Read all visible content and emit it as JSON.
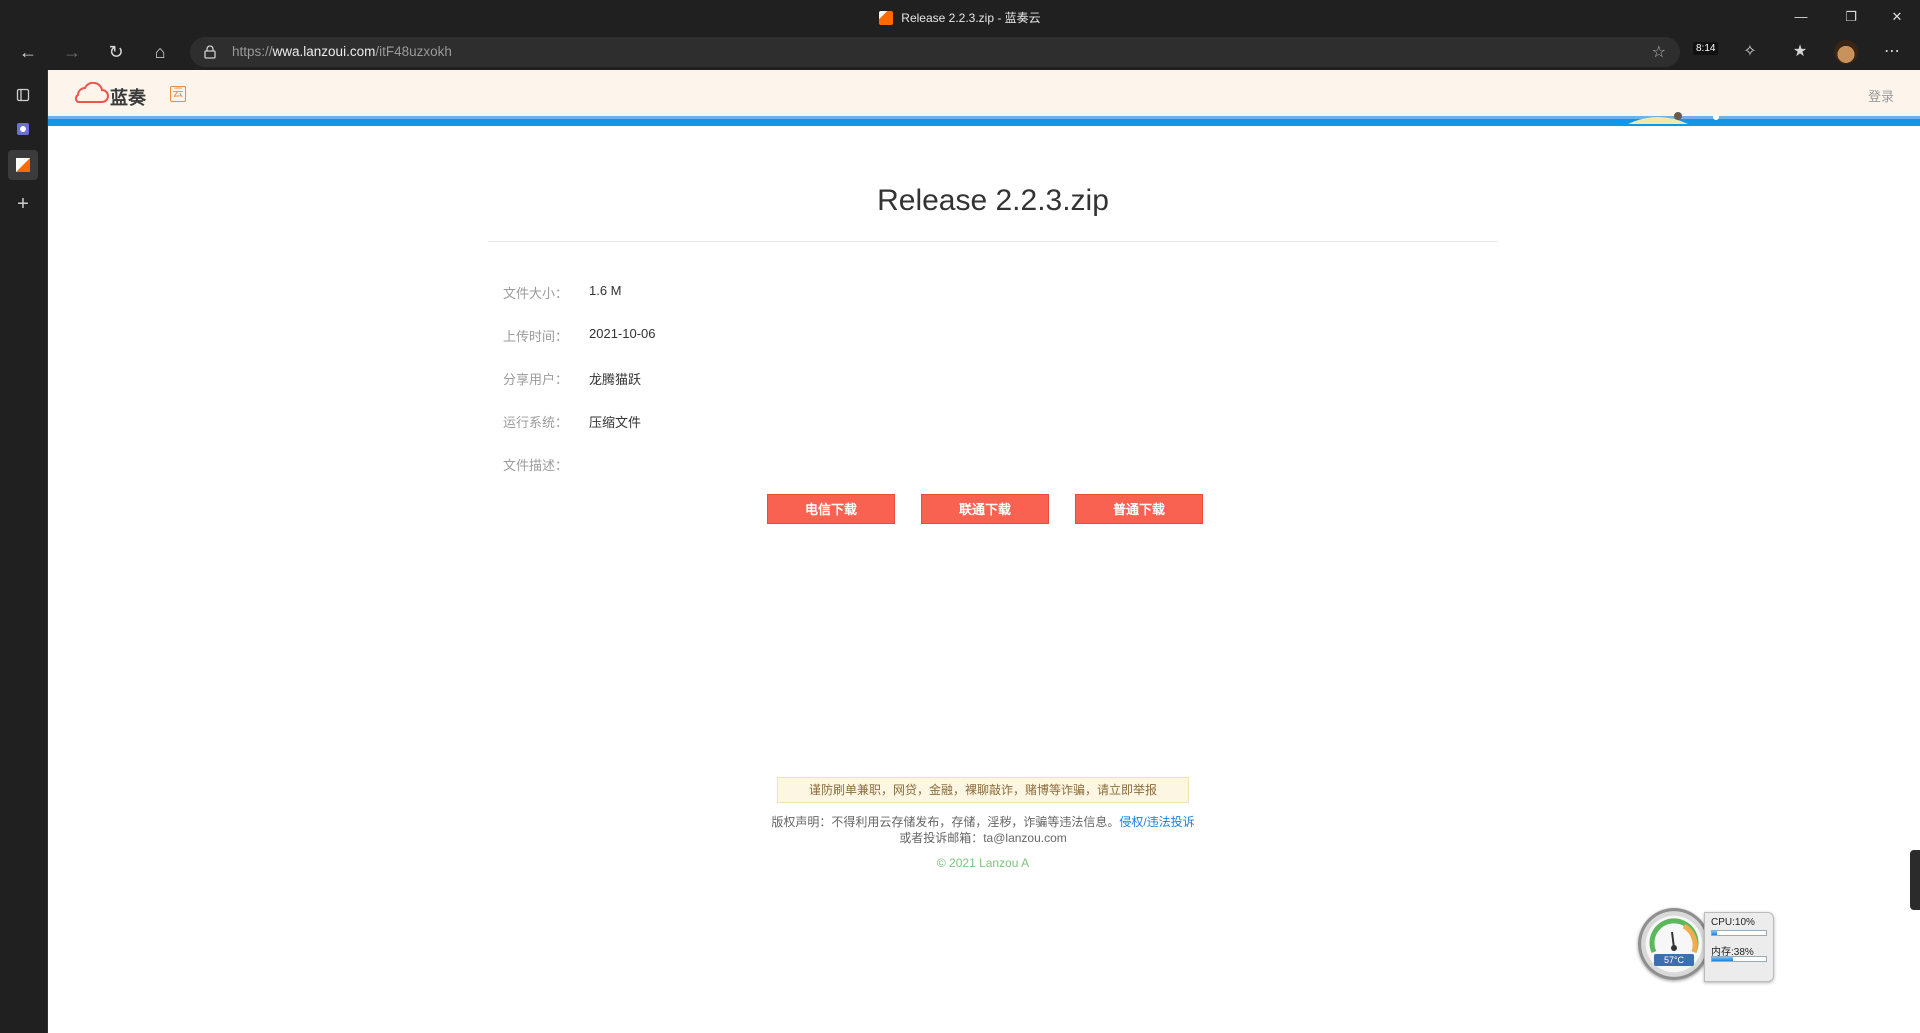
{
  "window": {
    "title": "Release 2.2.3.zip - 蓝奏云"
  },
  "browser": {
    "url_scheme": "https://",
    "url_host": "wwa.lanzoui.com",
    "url_path": "/itF48uzxokh",
    "clock_badge": "8:14"
  },
  "site": {
    "brand": "蓝奏",
    "brand_badge": "云",
    "login": "登录"
  },
  "file": {
    "name": "Release 2.2.3.zip",
    "rows": [
      {
        "label": "文件大小：",
        "value": "1.6 M"
      },
      {
        "label": "上传时间：",
        "value": "2021-10-06"
      },
      {
        "label": "分享用户：",
        "value": "龙腾猫跃"
      },
      {
        "label": "运行系统：",
        "value": "压缩文件"
      },
      {
        "label": "文件描述：",
        "value": ""
      }
    ]
  },
  "downloads": {
    "telecom": "电信下载",
    "unicom": "联通下载",
    "normal": "普通下载"
  },
  "notice": "谨防刷单兼职，网贷，金融，裸聊敲诈，赌博等诈骗，请立即举报",
  "copyright": {
    "text": "版权声明：不得利用云存储发布，存储，淫秽，诈骗等违法信息。",
    "link": "侵权/违法投诉",
    "email_line": "或者投诉邮箱：ta@lanzou.com"
  },
  "footer": "© 2021 Lanzou A",
  "monitor": {
    "cpu_label": "CPU:10%",
    "cpu": 0.1,
    "mem_label": "内存:38%",
    "mem": 0.38,
    "temp": "57°C"
  },
  "colors": {
    "accent_blue": "#1296e8",
    "download_button": "#f96250",
    "header_bg": "#fdf5ec"
  }
}
